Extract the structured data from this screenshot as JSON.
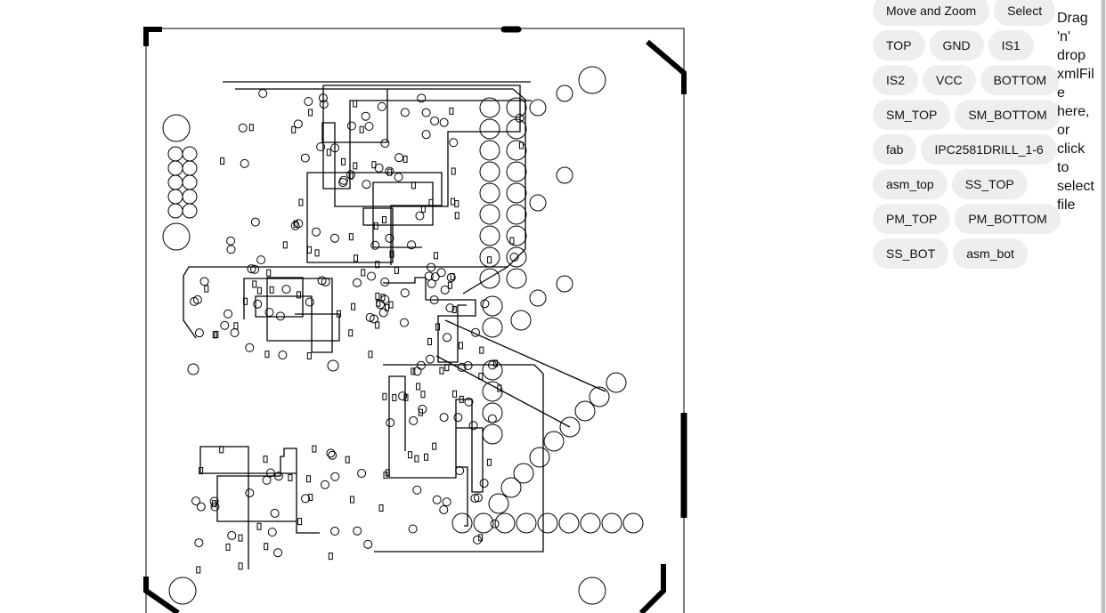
{
  "toolbar": {
    "rows": [
      [
        "Move and Zoom",
        "Select"
      ],
      [
        "TOP",
        "GND",
        "IS1"
      ],
      [
        "IS2",
        "VCC",
        "BOTTOM"
      ],
      [
        "SM_TOP",
        "SM_BOTTOM"
      ],
      [
        "fab",
        "IPC2581DRILL_1-6"
      ],
      [
        "asm_top",
        "SS_TOP"
      ],
      [
        "PM_TOP",
        "PM_BOTTOM"
      ],
      [
        "SS_BOT",
        "asm_bot"
      ]
    ]
  },
  "dropzone": {
    "text": "Drag 'n' drop xmlFile here, or click to select file"
  },
  "colors": {
    "stroke": "#000000",
    "via": "#2a2a6a",
    "button_bg": "#eeeeee"
  }
}
